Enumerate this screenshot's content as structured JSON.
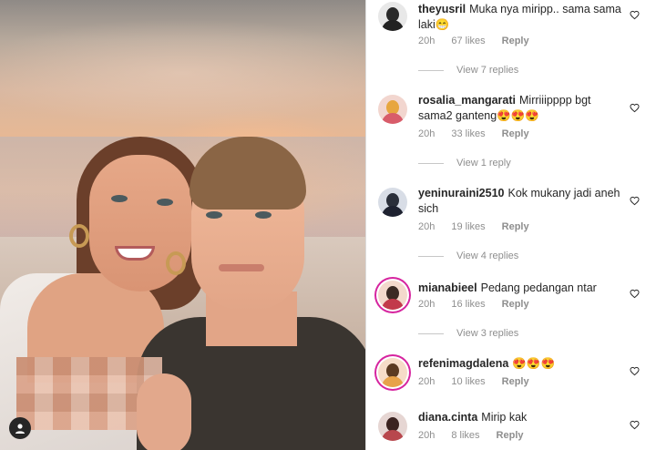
{
  "colors": {
    "meta": "#8e8e8e",
    "text": "#262626",
    "story_ring": "#d6249f"
  },
  "photo": {
    "profile_icon": "user-circle-icon"
  },
  "comments": [
    {
      "username": "theyusril",
      "text": "Muka nya miripp.. sama sama laki😁",
      "time": "20h",
      "likes": "67 likes",
      "reply": "Reply",
      "view_replies": "View 7 replies"
    },
    {
      "username": "rosalia_mangarati",
      "text": "Mirriiipppp bgt sama2 ganteng😍😍😍",
      "time": "20h",
      "likes": "33 likes",
      "reply": "Reply",
      "view_replies": "View 1 reply"
    },
    {
      "username": "yeninuraini2510",
      "text": "Kok mukany jadi aneh sich",
      "time": "20h",
      "likes": "19 likes",
      "reply": "Reply",
      "view_replies": "View 4 replies"
    },
    {
      "username": "mianabieel",
      "text": "Pedang pedangan ntar",
      "time": "20h",
      "likes": "16 likes",
      "reply": "Reply",
      "view_replies": "View 3 replies"
    },
    {
      "username": "refenimagdalena",
      "text": "😍😍😍",
      "time": "20h",
      "likes": "10 likes",
      "reply": "Reply",
      "view_replies": ""
    },
    {
      "username": "diana.cinta",
      "text": "Mirip kak",
      "time": "20h",
      "likes": "8 likes",
      "reply": "Reply",
      "view_replies": ""
    }
  ]
}
